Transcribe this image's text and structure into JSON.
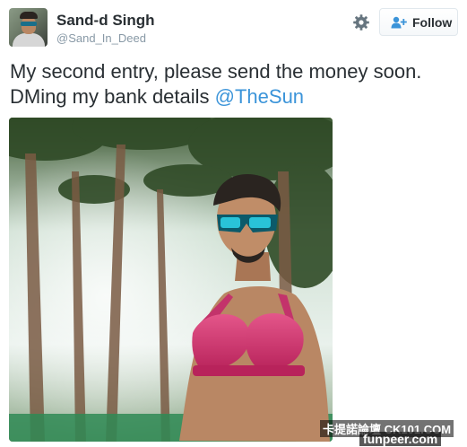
{
  "tweet": {
    "author_name": "Sand-d Singh",
    "author_handle": "@Sand_In_Deed",
    "text_line1": "My second entry, please send the money soon.",
    "text_line2_prefix": "DMing my bank details ",
    "mention": "@TheSun",
    "follow_label": "Follow"
  },
  "icons": {
    "settings": "gear-icon",
    "follow": "add-user-icon"
  },
  "watermarks": {
    "line1": "卡提諾論壇 CK101.COM",
    "line2": "funpeer.com"
  },
  "colors": {
    "link": "#3b94d9",
    "handle": "#8899a6",
    "text": "#292f33"
  }
}
